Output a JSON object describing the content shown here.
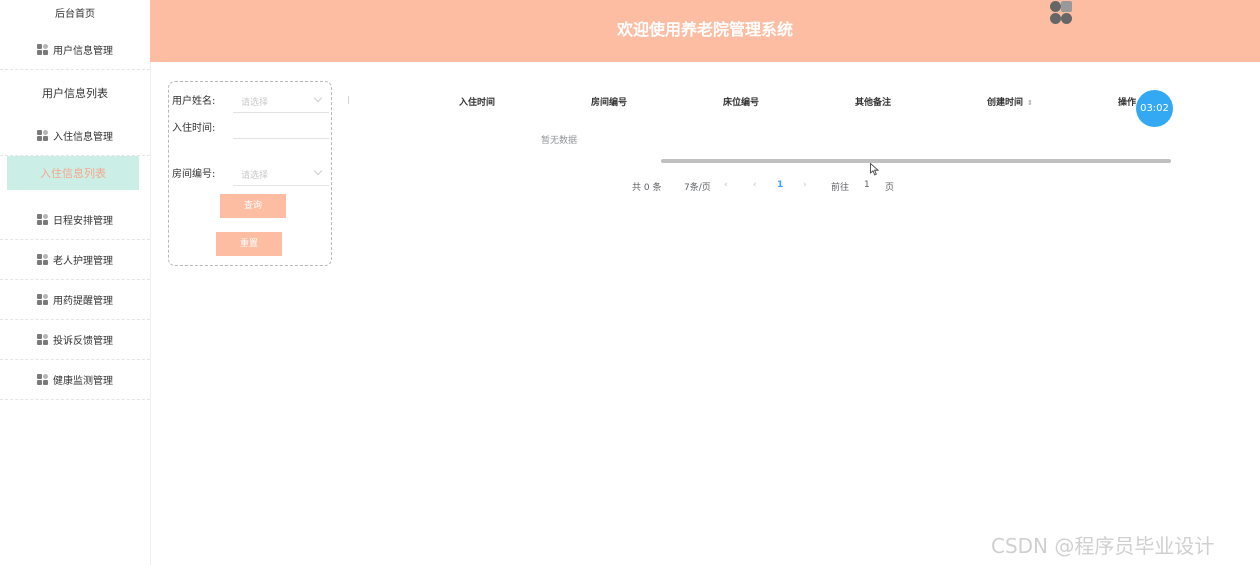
{
  "sidebar": {
    "home": "后台首页",
    "user_mgmt": "用户信息管理",
    "user_list": "用户信息列表",
    "checkin_mgmt": "入住信息管理",
    "checkin_list": "入住信息列表",
    "items": [
      {
        "label": "日程安排管理"
      },
      {
        "label": "老人护理管理"
      },
      {
        "label": "用药提醒管理"
      },
      {
        "label": "投诉反馈管理"
      },
      {
        "label": "健康监测管理"
      }
    ]
  },
  "header": {
    "title": "欢迎使用养老院管理系统",
    "logo_icon": "app-logo-icon"
  },
  "search": {
    "user_name_label": "用户姓名:",
    "user_name_placeholder": "请选择",
    "checkin_time_label": "入住时间:",
    "checkin_time_value": "",
    "room_no_label": "房间编号:",
    "room_no_placeholder": "请选择",
    "query_button": "查询",
    "reset_button": "重置"
  },
  "table": {
    "columns": [
      "入住时间",
      "房间编号",
      "床位编号",
      "其他备注",
      "创建时间",
      "操作"
    ],
    "sort_icon": "⇕",
    "empty_text": "暂无数据",
    "rows": []
  },
  "pagination": {
    "total": "共 0 条",
    "page_size": "7条/页",
    "prev_icon": "‹",
    "current_page": "1",
    "next_icon": "›",
    "goto_label": "前往",
    "goto_value": "1",
    "page_suffix": "页"
  },
  "timer": {
    "value": "03:02"
  },
  "watermark": "CSDN @程序员毕业设计",
  "colors": {
    "header_bg": "#fcbda2",
    "active_menu_bg": "#cbeee6",
    "active_menu_text": "#f5a88a",
    "button_bg": "#fcbda2",
    "timer_bg": "#33a9f4"
  }
}
